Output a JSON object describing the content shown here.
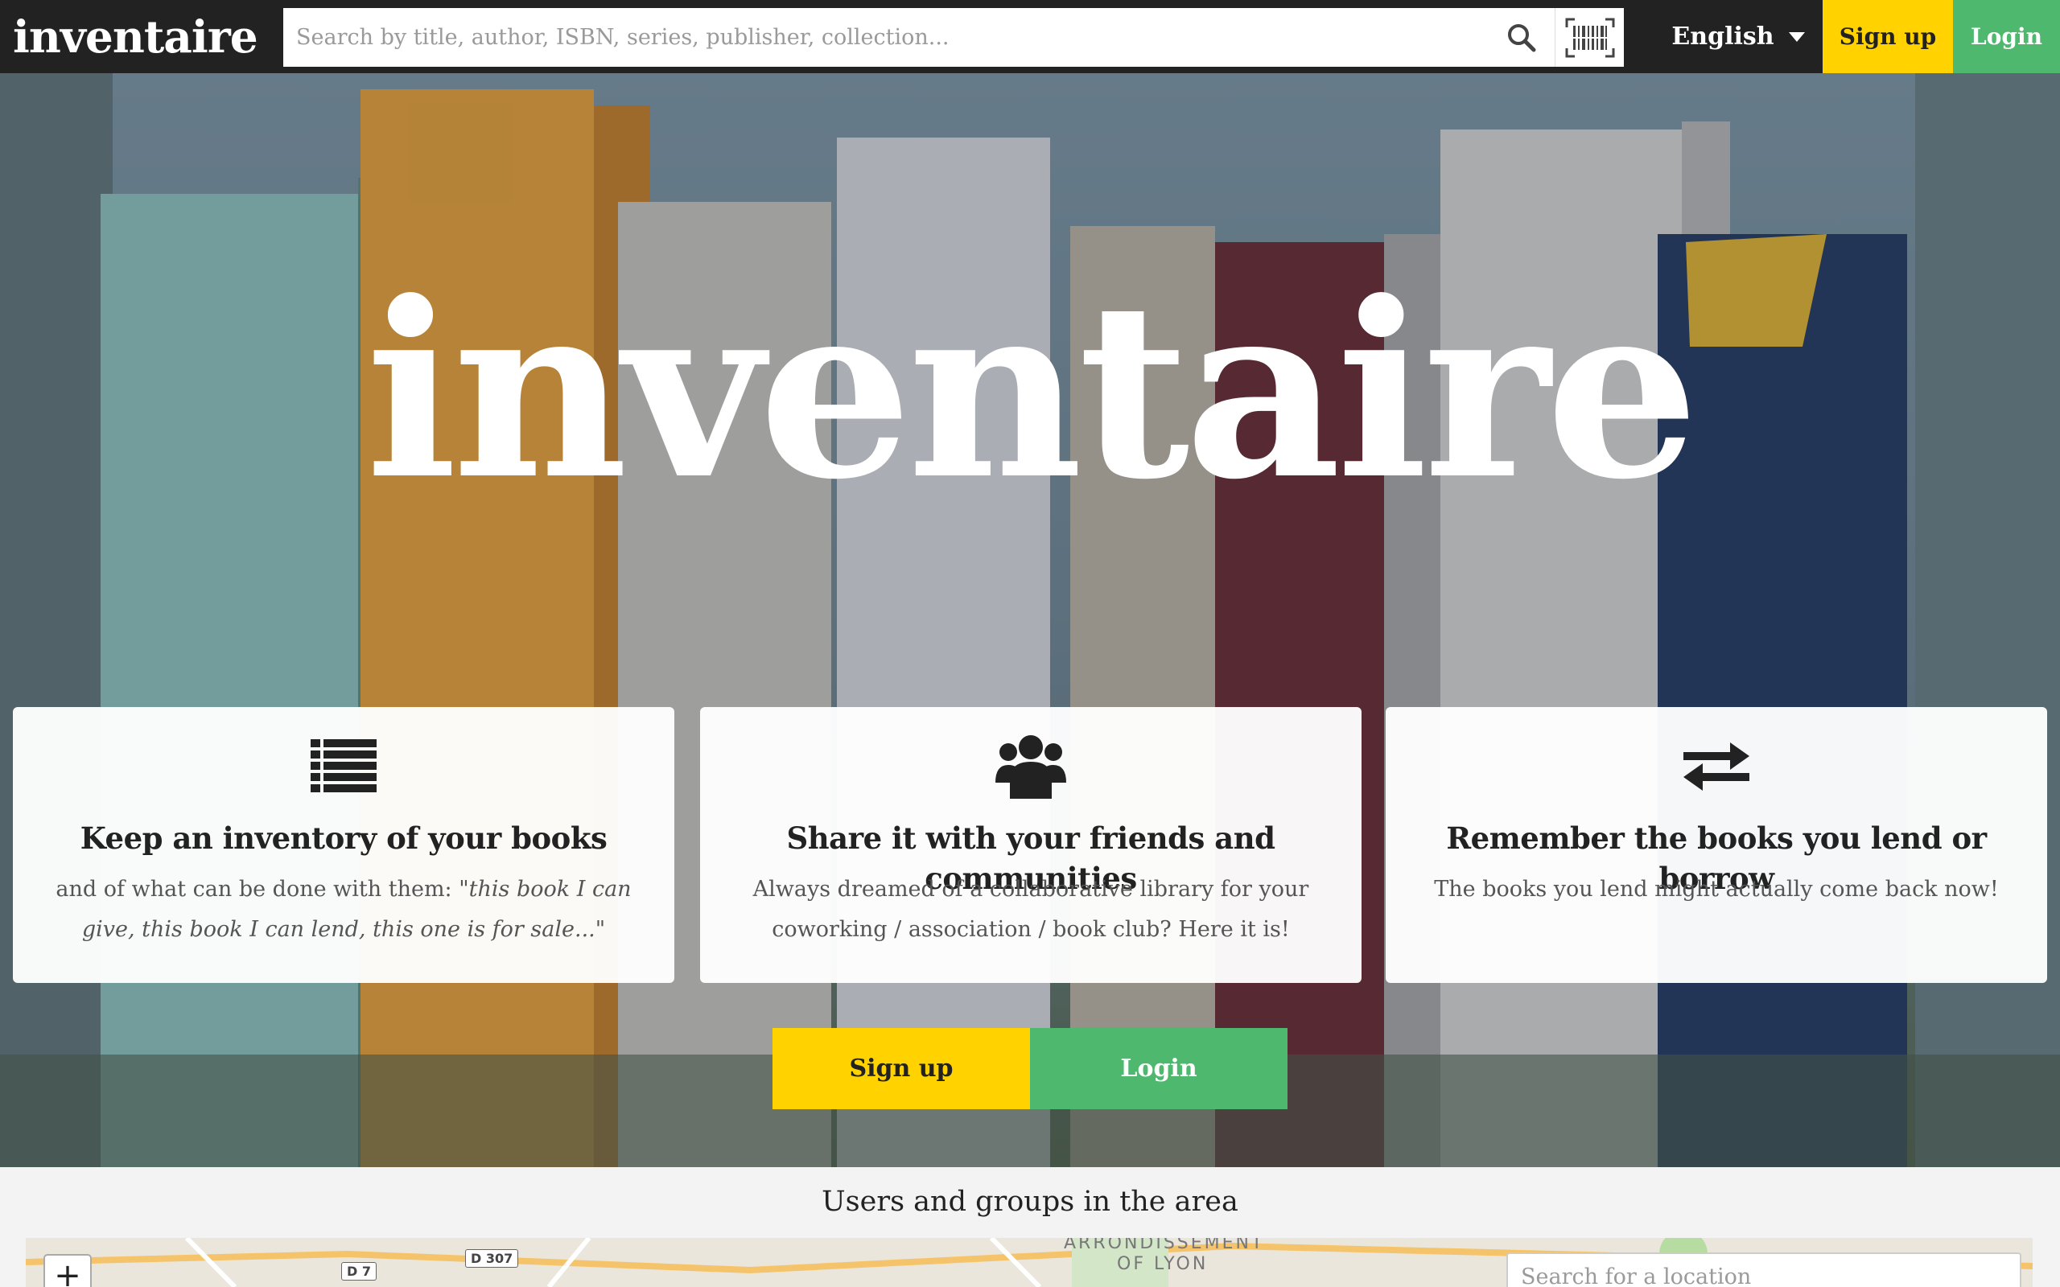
{
  "header": {
    "logo": "inventaire",
    "search_placeholder": "Search by title, author, ISBN, series, publisher, collection...",
    "language": "English",
    "signup_label": "Sign up",
    "login_label": "Login"
  },
  "hero": {
    "title": "inventaire",
    "cards": [
      {
        "icon": "list-icon",
        "title": "Keep an inventory of your books",
        "text_plain": "and of what can be done with them: \"",
        "text_italic": "this book I can give, this book I can lend, this one is for sale...",
        "text_end": "\""
      },
      {
        "icon": "users-icon",
        "title": "Share it with your friends and communities",
        "text": "Always dreamed of a collaborative library for your coworking / association / book club? Here it is!"
      },
      {
        "icon": "exchange-icon",
        "title": "Remember the books you lend or borrow",
        "text": "The books you lend might actually come back now!"
      }
    ],
    "signup_label": "Sign up",
    "login_label": "Login"
  },
  "area": {
    "title": "Users and groups in the area",
    "zoom_in": "+",
    "location_placeholder": "Search for a location",
    "map_labels": {
      "district_line1": "ARRONDISSEMENT",
      "district_line2": "OF LYON",
      "road_d7": "D 7",
      "road_d307": "D 307"
    }
  },
  "colors": {
    "topbar": "#222222",
    "signup": "#ffd200",
    "login": "#4eb86e"
  }
}
